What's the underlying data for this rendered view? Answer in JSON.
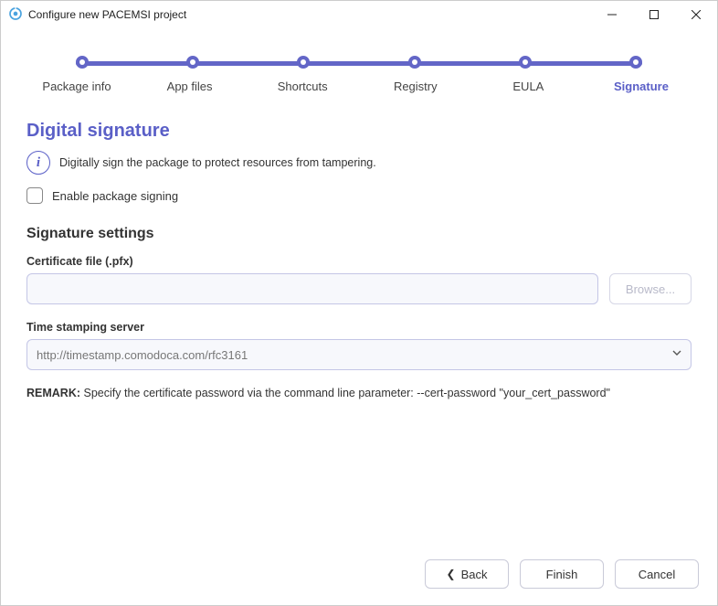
{
  "window": {
    "title": "Configure new PACEMSI project"
  },
  "steps": [
    {
      "label": "Package info",
      "active": false
    },
    {
      "label": "App files",
      "active": false
    },
    {
      "label": "Shortcuts",
      "active": false
    },
    {
      "label": "Registry",
      "active": false
    },
    {
      "label": "EULA",
      "active": false
    },
    {
      "label": "Signature",
      "active": true
    }
  ],
  "page": {
    "title": "Digital signature",
    "info": "Digitally sign the package to protect resources from tampering.",
    "enable_label": "Enable package signing",
    "enable_checked": false,
    "settings_title": "Signature settings",
    "cert_label": "Certificate file (.pfx)",
    "cert_value": "",
    "browse_label": "Browse...",
    "timestamp_label": "Time stamping server",
    "timestamp_value": "http://timestamp.comodoca.com/rfc3161",
    "remark_prefix": "REMARK:",
    "remark_text": " Specify the certificate password via the command line parameter: --cert-password \"your_cert_password\""
  },
  "footer": {
    "back": "Back",
    "finish": "Finish",
    "cancel": "Cancel"
  }
}
